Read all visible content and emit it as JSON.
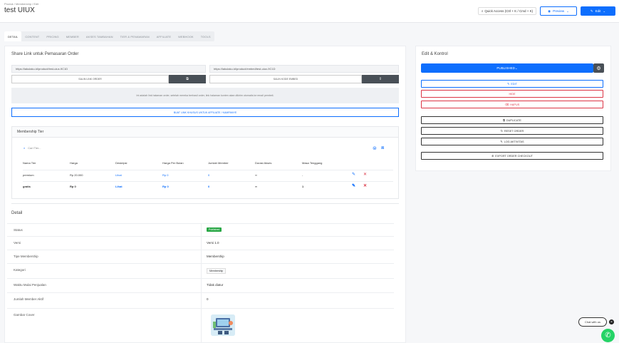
{
  "header": {
    "breadcrumb": "Produk / Membership / Edit",
    "title": "test UIUX",
    "quick_access": "Quick Access (Ctrl + K / Cmd + K)",
    "preview": "Preview",
    "edit": "Edit"
  },
  "tabs": [
    "DETAIL",
    "CONTENT",
    "PRICING",
    "MEMBER",
    "AKSES TAMBAHAN",
    "TIER & PENAWARAN",
    "AFFILIATE",
    "WEBHOOK",
    "TOOLS"
  ],
  "share": {
    "title": "Share Link untuk Pemasaran Order",
    "url1": "https://lakulaku.id/product/test-uiux-9C1D",
    "url2": "https://lakulaku.id/product/embed/test-uiux-9C1D",
    "copy1_label": "SALIN LINK ORDER",
    "copy2_label": "SALIN KODE EMBED",
    "copy_icon": "⧉",
    "share_icon": "⇪",
    "notice": "Ini adalah link halaman order, setelah mereka berhasil order, link halaman konten akan dikirim otomatis ke email pembeli.",
    "button": "BUAT LINK KHUSUS UNTUK AFFILIATE / KAMPANYE"
  },
  "tiers": {
    "title": "Membership Tier",
    "search_placeholder": "Cari Tier...",
    "columns": [
      "Nama Tier",
      "Harga",
      "Deskripsi",
      "Harga Per Bulan",
      "Jumlah Member",
      "Durasi Akses",
      "Masa Tenggang"
    ],
    "rows": [
      {
        "name": "premium",
        "price": "Rp 20.000",
        "desc": "Lihat",
        "per_month": "Rp 0",
        "members": "0",
        "duration": "∞",
        "grace": "-"
      },
      {
        "name": "gratis",
        "price": "Rp 0",
        "desc": "Lihat",
        "per_month": "Rp 0",
        "members": "0",
        "duration": "∞",
        "grace": "1"
      }
    ]
  },
  "detail": {
    "title": "Detail",
    "rows": [
      {
        "key": "Status",
        "value": "Published"
      },
      {
        "key": "Versi",
        "value": "Versi 1.0"
      },
      {
        "key": "Tipe Membership",
        "value": "Membership"
      },
      {
        "key": "Kategori",
        "value": "Membership"
      },
      {
        "key": "Waktu Mulai Penjualan",
        "value": "Tidak diatur"
      },
      {
        "key": "Jumlah Member Aktif",
        "value": "0"
      },
      {
        "key": "Gambar Cover",
        "value": ""
      }
    ]
  },
  "actions": {
    "title": "Edit & Kontrol",
    "publish": "PUBLISHED",
    "edit": "EDIT",
    "hide": "HIDE",
    "delete": "HAPUS",
    "duplicate": "DUPLICATE",
    "reset_order": "RESET ORDER",
    "log_aktivitas": "LOG AKTIVITAS",
    "export_order": "EXPORT ORDER CHECKOUT"
  },
  "widget": {
    "chat": "Chat with us"
  },
  "colors": {
    "primary": "#0d6efd",
    "danger": "#dc3545",
    "success": "#28a745",
    "dark": "#495057"
  }
}
